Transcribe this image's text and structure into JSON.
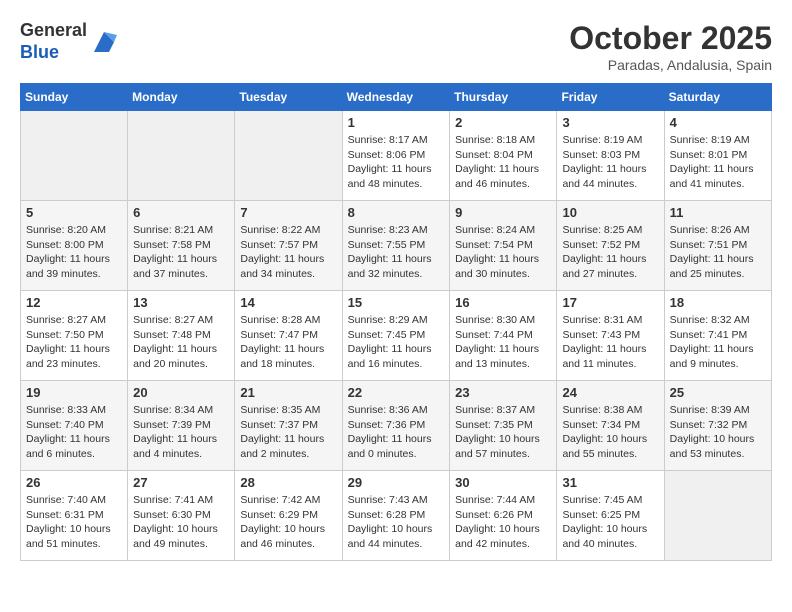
{
  "header": {
    "logo_line1": "General",
    "logo_line2": "Blue",
    "month_year": "October 2025",
    "location": "Paradas, Andalusia, Spain"
  },
  "days_of_week": [
    "Sunday",
    "Monday",
    "Tuesday",
    "Wednesday",
    "Thursday",
    "Friday",
    "Saturday"
  ],
  "weeks": [
    {
      "days": [
        {
          "num": "",
          "info": ""
        },
        {
          "num": "",
          "info": ""
        },
        {
          "num": "",
          "info": ""
        },
        {
          "num": "1",
          "info": "Sunrise: 8:17 AM\nSunset: 8:06 PM\nDaylight: 11 hours\nand 48 minutes."
        },
        {
          "num": "2",
          "info": "Sunrise: 8:18 AM\nSunset: 8:04 PM\nDaylight: 11 hours\nand 46 minutes."
        },
        {
          "num": "3",
          "info": "Sunrise: 8:19 AM\nSunset: 8:03 PM\nDaylight: 11 hours\nand 44 minutes."
        },
        {
          "num": "4",
          "info": "Sunrise: 8:19 AM\nSunset: 8:01 PM\nDaylight: 11 hours\nand 41 minutes."
        }
      ]
    },
    {
      "days": [
        {
          "num": "5",
          "info": "Sunrise: 8:20 AM\nSunset: 8:00 PM\nDaylight: 11 hours\nand 39 minutes."
        },
        {
          "num": "6",
          "info": "Sunrise: 8:21 AM\nSunset: 7:58 PM\nDaylight: 11 hours\nand 37 minutes."
        },
        {
          "num": "7",
          "info": "Sunrise: 8:22 AM\nSunset: 7:57 PM\nDaylight: 11 hours\nand 34 minutes."
        },
        {
          "num": "8",
          "info": "Sunrise: 8:23 AM\nSunset: 7:55 PM\nDaylight: 11 hours\nand 32 minutes."
        },
        {
          "num": "9",
          "info": "Sunrise: 8:24 AM\nSunset: 7:54 PM\nDaylight: 11 hours\nand 30 minutes."
        },
        {
          "num": "10",
          "info": "Sunrise: 8:25 AM\nSunset: 7:52 PM\nDaylight: 11 hours\nand 27 minutes."
        },
        {
          "num": "11",
          "info": "Sunrise: 8:26 AM\nSunset: 7:51 PM\nDaylight: 11 hours\nand 25 minutes."
        }
      ]
    },
    {
      "days": [
        {
          "num": "12",
          "info": "Sunrise: 8:27 AM\nSunset: 7:50 PM\nDaylight: 11 hours\nand 23 minutes."
        },
        {
          "num": "13",
          "info": "Sunrise: 8:27 AM\nSunset: 7:48 PM\nDaylight: 11 hours\nand 20 minutes."
        },
        {
          "num": "14",
          "info": "Sunrise: 8:28 AM\nSunset: 7:47 PM\nDaylight: 11 hours\nand 18 minutes."
        },
        {
          "num": "15",
          "info": "Sunrise: 8:29 AM\nSunset: 7:45 PM\nDaylight: 11 hours\nand 16 minutes."
        },
        {
          "num": "16",
          "info": "Sunrise: 8:30 AM\nSunset: 7:44 PM\nDaylight: 11 hours\nand 13 minutes."
        },
        {
          "num": "17",
          "info": "Sunrise: 8:31 AM\nSunset: 7:43 PM\nDaylight: 11 hours\nand 11 minutes."
        },
        {
          "num": "18",
          "info": "Sunrise: 8:32 AM\nSunset: 7:41 PM\nDaylight: 11 hours\nand 9 minutes."
        }
      ]
    },
    {
      "days": [
        {
          "num": "19",
          "info": "Sunrise: 8:33 AM\nSunset: 7:40 PM\nDaylight: 11 hours\nand 6 minutes."
        },
        {
          "num": "20",
          "info": "Sunrise: 8:34 AM\nSunset: 7:39 PM\nDaylight: 11 hours\nand 4 minutes."
        },
        {
          "num": "21",
          "info": "Sunrise: 8:35 AM\nSunset: 7:37 PM\nDaylight: 11 hours\nand 2 minutes."
        },
        {
          "num": "22",
          "info": "Sunrise: 8:36 AM\nSunset: 7:36 PM\nDaylight: 11 hours\nand 0 minutes."
        },
        {
          "num": "23",
          "info": "Sunrise: 8:37 AM\nSunset: 7:35 PM\nDaylight: 10 hours\nand 57 minutes."
        },
        {
          "num": "24",
          "info": "Sunrise: 8:38 AM\nSunset: 7:34 PM\nDaylight: 10 hours\nand 55 minutes."
        },
        {
          "num": "25",
          "info": "Sunrise: 8:39 AM\nSunset: 7:32 PM\nDaylight: 10 hours\nand 53 minutes."
        }
      ]
    },
    {
      "days": [
        {
          "num": "26",
          "info": "Sunrise: 7:40 AM\nSunset: 6:31 PM\nDaylight: 10 hours\nand 51 minutes."
        },
        {
          "num": "27",
          "info": "Sunrise: 7:41 AM\nSunset: 6:30 PM\nDaylight: 10 hours\nand 49 minutes."
        },
        {
          "num": "28",
          "info": "Sunrise: 7:42 AM\nSunset: 6:29 PM\nDaylight: 10 hours\nand 46 minutes."
        },
        {
          "num": "29",
          "info": "Sunrise: 7:43 AM\nSunset: 6:28 PM\nDaylight: 10 hours\nand 44 minutes."
        },
        {
          "num": "30",
          "info": "Sunrise: 7:44 AM\nSunset: 6:26 PM\nDaylight: 10 hours\nand 42 minutes."
        },
        {
          "num": "31",
          "info": "Sunrise: 7:45 AM\nSunset: 6:25 PM\nDaylight: 10 hours\nand 40 minutes."
        },
        {
          "num": "",
          "info": ""
        }
      ]
    }
  ]
}
